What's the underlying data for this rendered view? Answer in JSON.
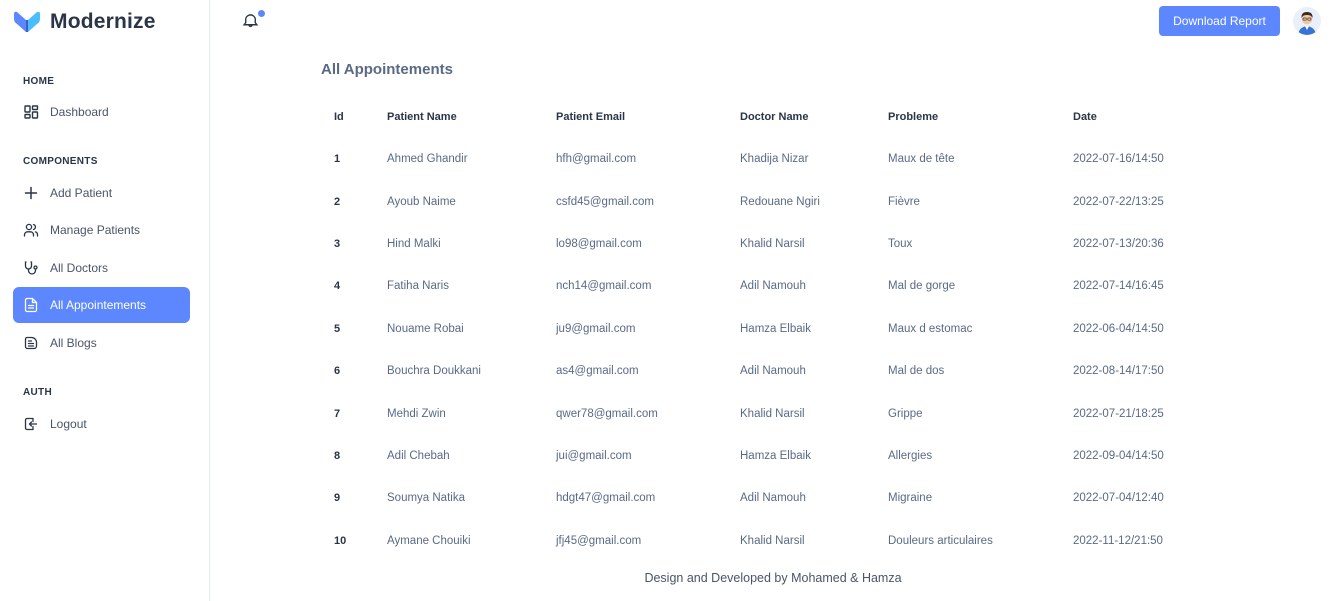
{
  "brand": {
    "name": "Modernize"
  },
  "sidebar": {
    "sections": [
      {
        "label": "HOME"
      },
      {
        "label": "COMPONENTS"
      },
      {
        "label": "AUTH"
      }
    ],
    "items": [
      {
        "label": "Dashboard",
        "icon": "layout-dashboard-icon"
      },
      {
        "label": "Add Patient",
        "icon": "plus-icon"
      },
      {
        "label": "Manage Patients",
        "icon": "users-icon"
      },
      {
        "label": "All Doctors",
        "icon": "stethoscope-icon"
      },
      {
        "label": "All Appointements",
        "icon": "file-description-icon",
        "active": true
      },
      {
        "label": "All Blogs",
        "icon": "article-icon"
      },
      {
        "label": "Logout",
        "icon": "logout-icon"
      }
    ]
  },
  "header": {
    "download_label": "Download Report",
    "accent_color": "#5d87ff"
  },
  "main": {
    "title": "All Appointements",
    "columns": [
      "Id",
      "Patient Name",
      "Patient Email",
      "Doctor Name",
      "Probleme",
      "Date"
    ],
    "rows": [
      [
        "1",
        "Ahmed Ghandir",
        "hfh@gmail.com",
        "Khadija Nizar",
        "Maux de tête",
        "2022-07-16/14:50"
      ],
      [
        "2",
        "Ayoub Naime",
        "csfd45@gmail.com",
        "Redouane Ngiri",
        "Fièvre",
        "2022-07-22/13:25"
      ],
      [
        "3",
        "Hind Malki",
        "lo98@gmail.com",
        "Khalid Narsil",
        "Toux",
        "2022-07-13/20:36"
      ],
      [
        "4",
        "Fatiha Naris",
        "nch14@gmail.com",
        "Adil Namouh",
        "Mal de gorge",
        "2022-07-14/16:45"
      ],
      [
        "5",
        "Nouame Robai",
        "ju9@gmail.com",
        "Hamza Elbaik",
        "Maux d estomac",
        "2022-06-04/14:50"
      ],
      [
        "6",
        "Bouchra Doukkani",
        "as4@gmail.com",
        "Adil Namouh",
        "Mal de dos",
        "2022-08-14/17:50"
      ],
      [
        "7",
        "Mehdi Zwin",
        "qwer78@gmail.com",
        "Khalid Narsil",
        "Grippe",
        "2022-07-21/18:25"
      ],
      [
        "8",
        "Adil Chebah",
        "jui@gmail.com",
        "Hamza Elbaik",
        "Allergies",
        "2022-09-04/14:50"
      ],
      [
        "9",
        "Soumya Natika",
        "hdgt47@gmail.com",
        "Adil Namouh",
        "Migraine",
        "2022-07-04/12:40"
      ],
      [
        "10",
        "Aymane Chouiki",
        "jfj45@gmail.com",
        "Khalid Narsil",
        "Douleurs articulaires",
        "2022-11-12/21:50"
      ]
    ]
  },
  "footer": {
    "text": "Design and Developed by Mohamed & Hamza"
  }
}
